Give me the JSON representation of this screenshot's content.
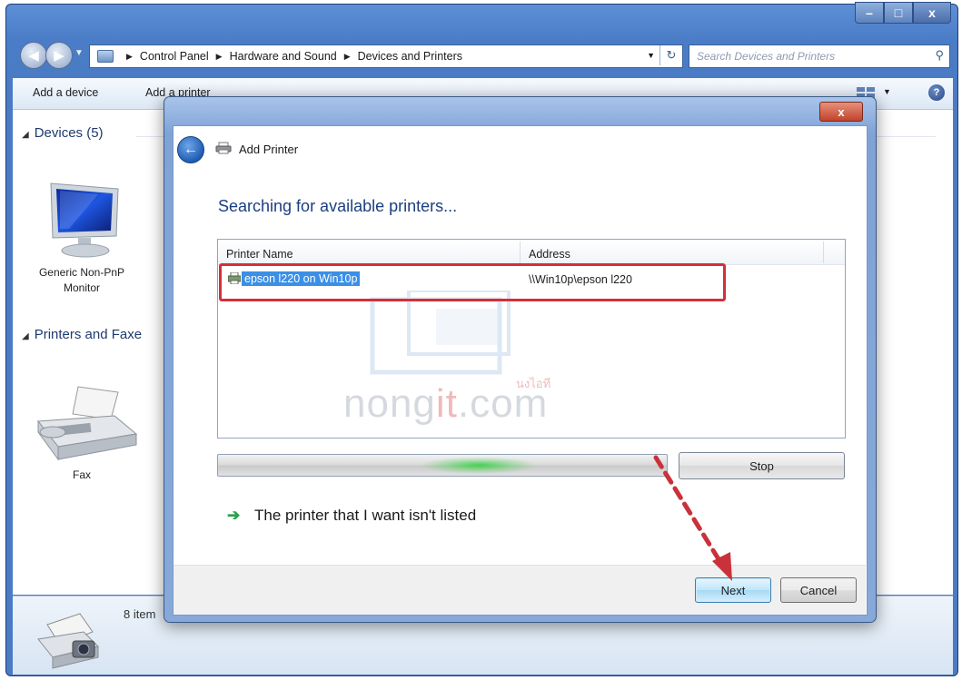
{
  "window": {
    "breadcrumb": [
      "Control Panel",
      "Hardware and Sound",
      "Devices and Printers"
    ],
    "search_placeholder": "Search Devices and Printers",
    "minimize_glyph": "–",
    "maximize_glyph": "□",
    "close_glyph": "x"
  },
  "command_bar": {
    "add_device": "Add a device",
    "add_printer": "Add a printer",
    "help_glyph": "?"
  },
  "content": {
    "devices_header": "Devices (5)",
    "printers_header": "Printers and Faxe",
    "monitor_label": "Generic Non-PnP Monitor",
    "fax_label": "Fax",
    "items_count": "8 item"
  },
  "dialog": {
    "title": "Add Printer",
    "close_glyph": "x",
    "heading": "Searching for available printers...",
    "columns": {
      "name": "Printer Name",
      "address": "Address"
    },
    "printers": [
      {
        "name": "epson l220 on Win10p",
        "address": "\\\\Win10p\\epson l220"
      }
    ],
    "stop_label": "Stop",
    "not_listed": "The printer that I want isn't listed",
    "next_label": "Next",
    "cancel_label": "Cancel",
    "progress": 0.58
  },
  "watermark": {
    "text_before": "nong",
    "text_red": "it",
    "text_after": ".com",
    "subtext": "นงไอที"
  },
  "colors": {
    "selection": "#3b8fe6",
    "highlight_box": "#d2303a",
    "annotation_arrow": "#c9323a",
    "progress_glow": "#3fd149",
    "heading": "#1b3f80"
  },
  "icons": {
    "back": "back-arrow-icon",
    "forward": "forward-arrow-icon",
    "search": "search-icon",
    "help": "help-icon",
    "printer": "printer-icon",
    "monitor": "monitor-icon",
    "fax": "fax-icon",
    "not_listed": "green-arrow-icon"
  }
}
